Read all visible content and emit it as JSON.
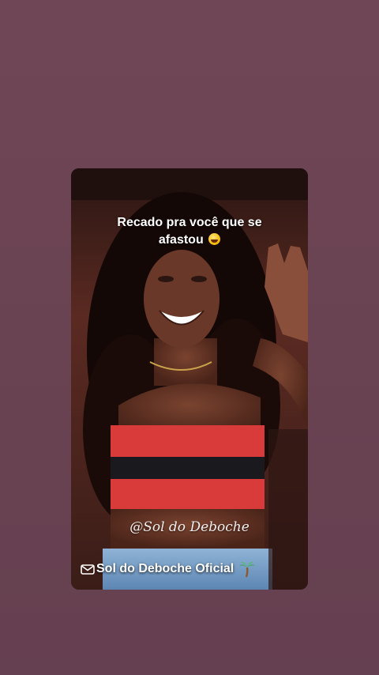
{
  "story": {
    "background_color": "#6e4655"
  },
  "video": {
    "caption_line1": "Recado pra você que se",
    "caption_line2": "afastou",
    "caption_emoji": "grinning-sweat-emoji",
    "watermark": "@Sol do Deboche",
    "channel_name": "Sol do Deboche Oficial",
    "channel_icon": "envelope-icon",
    "channel_trailing_icon": "palm-tree-icon"
  }
}
